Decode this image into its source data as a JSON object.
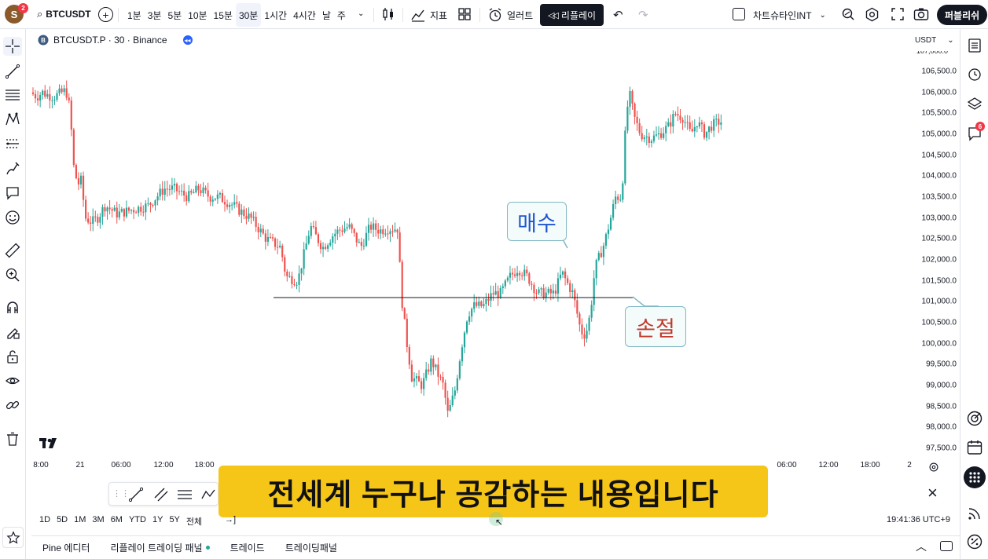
{
  "topbar": {
    "avatar_letter": "S",
    "avatar_badge": "2",
    "symbol": "BTCUSDT",
    "intervals": [
      "1분",
      "3분",
      "5분",
      "10분",
      "15분",
      "30분",
      "1시간",
      "4시간",
      "날",
      "주"
    ],
    "active_interval": "30분",
    "indicators_label": "지표",
    "alert_label": "얼러트",
    "replay_label": "리플레이",
    "layout_name": "차트슈타인INT",
    "publish_label": "퍼블리쉬"
  },
  "chart": {
    "title": "BTCUSDT.P · 30 · Binance",
    "currency": "USDT",
    "colors": {
      "up": "#26a69a",
      "down": "#ef5350",
      "line": "#131722",
      "subtitle_bg": "#f5c518"
    }
  },
  "annotations": {
    "buy_label": "매수",
    "stop_label": "손절",
    "subtitle": "전세계 누구나 공감하는 내용입니다"
  },
  "chart_data": {
    "type": "candlestick",
    "title": "BTCUSDT.P · 30 · Binance",
    "y_ticks": [
      "106,500.0",
      "106,000.0",
      "105,500.0",
      "105,000.0",
      "104,500.0",
      "104,000.0",
      "103,500.0",
      "103,000.0",
      "102,500.0",
      "102,000.0",
      "101,500.0",
      "101,000.0",
      "100,500.0",
      "100,000.0",
      "99,500.0",
      "99,000.0",
      "98,500.0",
      "98,000.0",
      "97,500.0"
    ],
    "ylim": [
      97300,
      106900
    ],
    "x_ticks": [
      "8:00",
      "21",
      "06:00",
      "12:00",
      "18:00",
      "06:00",
      "12:00",
      "18:00",
      "2"
    ],
    "horizontal_line": 101100,
    "path": [
      [
        0,
        106000
      ],
      [
        8,
        105900
      ],
      [
        15,
        106000
      ],
      [
        20,
        105950
      ],
      [
        30,
        105900
      ],
      [
        45,
        106050
      ],
      [
        50,
        105600
      ],
      [
        55,
        104200
      ],
      [
        60,
        103800
      ],
      [
        64,
        103900
      ],
      [
        70,
        103000
      ],
      [
        78,
        102900
      ],
      [
        85,
        103000
      ],
      [
        95,
        103300
      ],
      [
        110,
        103100
      ],
      [
        130,
        103200
      ],
      [
        150,
        103300
      ],
      [
        170,
        103700
      ],
      [
        182,
        103700
      ],
      [
        200,
        103500
      ],
      [
        214,
        103700
      ],
      [
        228,
        103500
      ],
      [
        240,
        103500
      ],
      [
        258,
        103300
      ],
      [
        264,
        103200
      ],
      [
        280,
        103000
      ],
      [
        300,
        102500
      ],
      [
        318,
        102300
      ],
      [
        325,
        101600
      ],
      [
        340,
        101500
      ],
      [
        356,
        102800
      ],
      [
        368,
        102400
      ],
      [
        372,
        102300
      ],
      [
        385,
        102600
      ],
      [
        392,
        102700
      ],
      [
        405,
        102800
      ],
      [
        420,
        102300
      ],
      [
        432,
        102800
      ],
      [
        444,
        102700
      ],
      [
        455,
        102750
      ],
      [
        467,
        102750
      ],
      [
        472,
        101100
      ],
      [
        478,
        100100
      ],
      [
        485,
        99200
      ],
      [
        498,
        99000
      ],
      [
        510,
        99600
      ],
      [
        525,
        99000
      ],
      [
        531,
        98300
      ],
      [
        540,
        98900
      ],
      [
        548,
        99900
      ],
      [
        556,
        100700
      ],
      [
        564,
        100900
      ],
      [
        576,
        100900
      ],
      [
        588,
        101200
      ],
      [
        598,
        101200
      ],
      [
        610,
        101600
      ],
      [
        620,
        101800
      ],
      [
        632,
        101600
      ],
      [
        645,
        101200
      ],
      [
        660,
        101200
      ],
      [
        666,
        101200
      ],
      [
        676,
        101700
      ],
      [
        684,
        101400
      ],
      [
        690,
        101200
      ],
      [
        700,
        100300
      ],
      [
        706,
        100200
      ],
      [
        712,
        100700
      ],
      [
        718,
        101800
      ],
      [
        730,
        102400
      ],
      [
        738,
        103000
      ],
      [
        744,
        103500
      ],
      [
        752,
        103500
      ],
      [
        758,
        105500
      ],
      [
        762,
        105950
      ],
      [
        768,
        105400
      ],
      [
        776,
        105000
      ],
      [
        790,
        104900
      ],
      [
        800,
        105000
      ],
      [
        812,
        105200
      ],
      [
        820,
        105500
      ],
      [
        830,
        105400
      ],
      [
        840,
        105000
      ],
      [
        848,
        105300
      ],
      [
        858,
        105000
      ],
      [
        866,
        105200
      ],
      [
        876,
        105300
      ]
    ]
  },
  "time_axis": {
    "left_labels": [
      "8:00",
      "21",
      "06:00",
      "12:00",
      "18:00"
    ],
    "right_labels": [
      "06:00",
      "12:00",
      "18:00",
      "2"
    ]
  },
  "bottom": {
    "ranges": [
      "1D",
      "5D",
      "1M",
      "3M",
      "6M",
      "YTD",
      "1Y",
      "5Y",
      "전체"
    ],
    "clock": "19:41:36 UTC+9",
    "tabs": [
      "Pine 에디터",
      "리플레이 트레이딩 패널",
      "트레이드",
      "트레이딩패널"
    ]
  },
  "rightbar": {
    "notification_badge": "6"
  }
}
